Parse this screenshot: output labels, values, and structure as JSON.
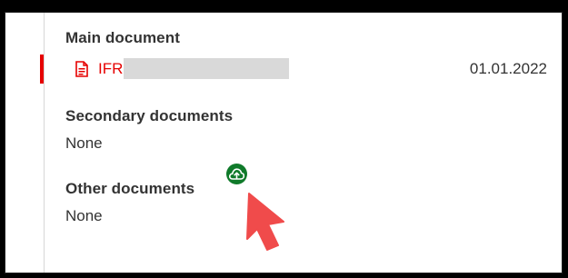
{
  "sections": {
    "main": {
      "title": "Main document",
      "document": {
        "name_prefix": "IFR",
        "date": "01.01.2022",
        "icon": "pdf-document-icon"
      }
    },
    "secondary": {
      "title": "Secondary documents",
      "value": "None"
    },
    "other": {
      "title": "Other documents",
      "value": "None",
      "action_icon": "cloud-upload-icon"
    }
  },
  "colors": {
    "accent_red": "#e60000",
    "upload_green": "#0f7a2a",
    "cursor_red": "#f04b4b"
  },
  "pointer": {
    "icon": "mouse-pointer-icon"
  }
}
